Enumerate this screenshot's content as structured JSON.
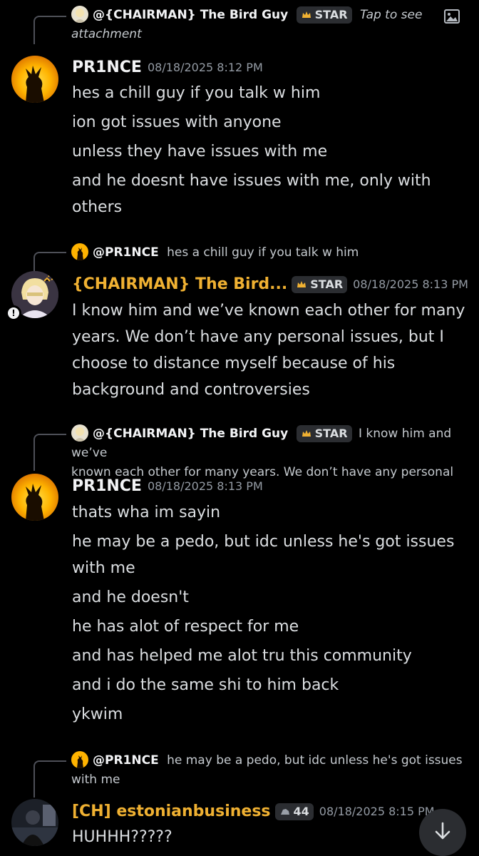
{
  "colors": {
    "background": "#000000",
    "gold": "#f0b132",
    "text": "#dbdee1",
    "muted": "#949ba4"
  },
  "messages": [
    {
      "reply": {
        "name": "@{CHAIRMAN} The Bird Guy",
        "badge": "STAR",
        "snippet_italic": "Tap to see",
        "snippet_italic_2": "attachment"
      },
      "author": "PR1NCE",
      "timestamp": "08/18/2025 8:12 PM",
      "lines": [
        "hes a chill guy if you talk w him",
        "ion got issues with anyone",
        "unless they have issues with me",
        "and he doesnt have issues with me, only with",
        "others"
      ]
    },
    {
      "reply": {
        "name": "@PR1NCE",
        "snippet": "hes a chill guy if you talk w him"
      },
      "author": "{CHAIRMAN} The Bird...",
      "badge": "STAR",
      "timestamp": "08/18/2025 8:13 PM",
      "lines": [
        "I know him and we’ve known each other for many",
        "years. We don’t have any personal issues, but I",
        "choose to distance myself because of his",
        "background and controversies"
      ]
    },
    {
      "reply": {
        "name": "@{CHAIRMAN} The Bird Guy",
        "badge": "STAR",
        "snippet": "I know him and we’ve",
        "snippet_2": "known each other for many years. We don’t have any personal"
      },
      "author": "PR1NCE",
      "timestamp": "08/18/2025 8:13 PM",
      "lines": [
        "thats wha im sayin",
        "he may be a pedo, but idc unless he's got issues",
        "with me",
        "and he doesn't",
        "he has alot of respect for me",
        "and has helped me alot tru this community",
        "and i do the same shi to him back",
        "ykwim"
      ]
    },
    {
      "reply": {
        "name": "@PR1NCE",
        "snippet": "he may be a pedo, but idc unless he's got issues",
        "snippet_2": "with me"
      },
      "author": "[CH] estonianbusiness",
      "badge": "44",
      "timestamp": "08/18/2025 8:15 PM",
      "lines": [
        "HUHHH?????"
      ]
    }
  ]
}
